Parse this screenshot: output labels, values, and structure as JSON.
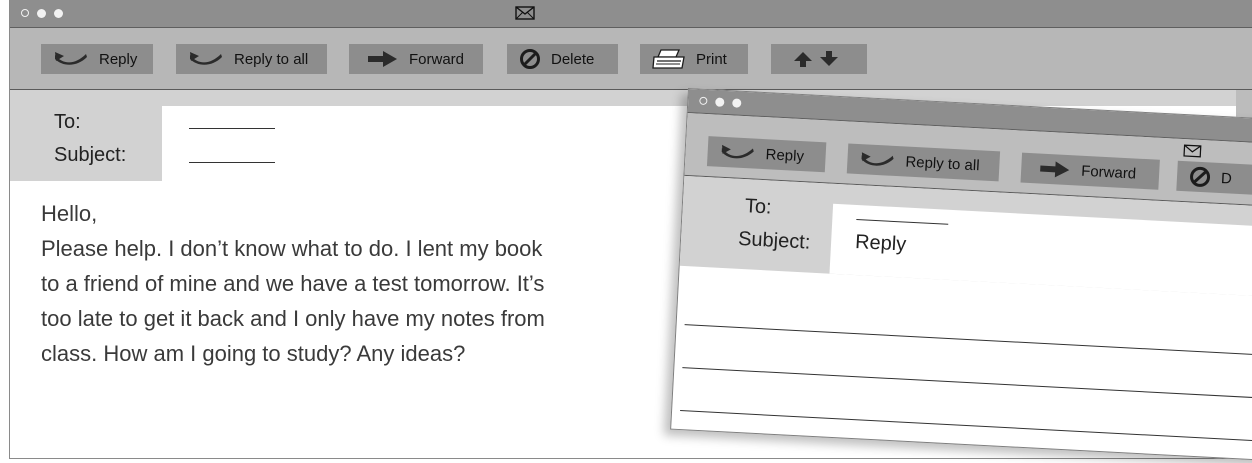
{
  "main_window": {
    "toolbar": {
      "reply_label": "Reply",
      "reply_all_label": "Reply to all",
      "forward_label": "Forward",
      "delete_label": "Delete",
      "print_label": "Print"
    },
    "header": {
      "to_label": "To:",
      "subject_label": "Subject:"
    },
    "message_lines": [
      "Hello,",
      "Please help. I don’t know what to do. I lent my book",
      "to a friend of mine and we have a test tomorrow. It’s",
      "too late to get it back and I only have my notes from",
      "class. How am I going to study? Any ideas?"
    ]
  },
  "reply_window": {
    "toolbar": {
      "reply_label": "Reply",
      "reply_all_label": "Reply to all",
      "forward_label": "Forward",
      "delete_label_visible": "D"
    },
    "header": {
      "to_label": "To:",
      "subject_label": "Subject:",
      "subject_value": "Reply"
    }
  },
  "icons": [
    "window-dot-icon",
    "envelope-icon",
    "reply-arrow-icon",
    "reply-all-arrow-icon",
    "forward-arrow-icon",
    "delete-icon",
    "printer-icon",
    "up-arrow-icon",
    "down-arrow-icon"
  ],
  "colors": {
    "titlebar": "#8e8e8e",
    "toolbar": "#b7b7b7",
    "button": "#8d8d8d",
    "header": "#d2d2d2"
  }
}
